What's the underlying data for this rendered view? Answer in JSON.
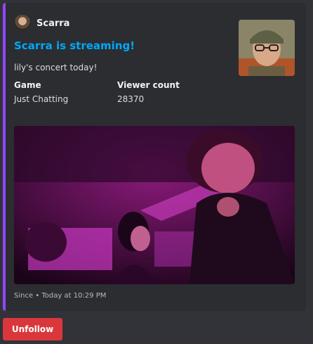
{
  "author": {
    "name": "Scarra"
  },
  "embed": {
    "title": "Scarra is streaming!",
    "description": "lily's concert today!",
    "fields": [
      {
        "name": "Game",
        "value": "Just Chatting"
      },
      {
        "name": "Viewer count",
        "value": "28370"
      }
    ],
    "footer": "Since • Today at 10:29 PM",
    "accent_color": "#9146ff"
  },
  "actions": {
    "unfollow_label": "Unfollow"
  }
}
